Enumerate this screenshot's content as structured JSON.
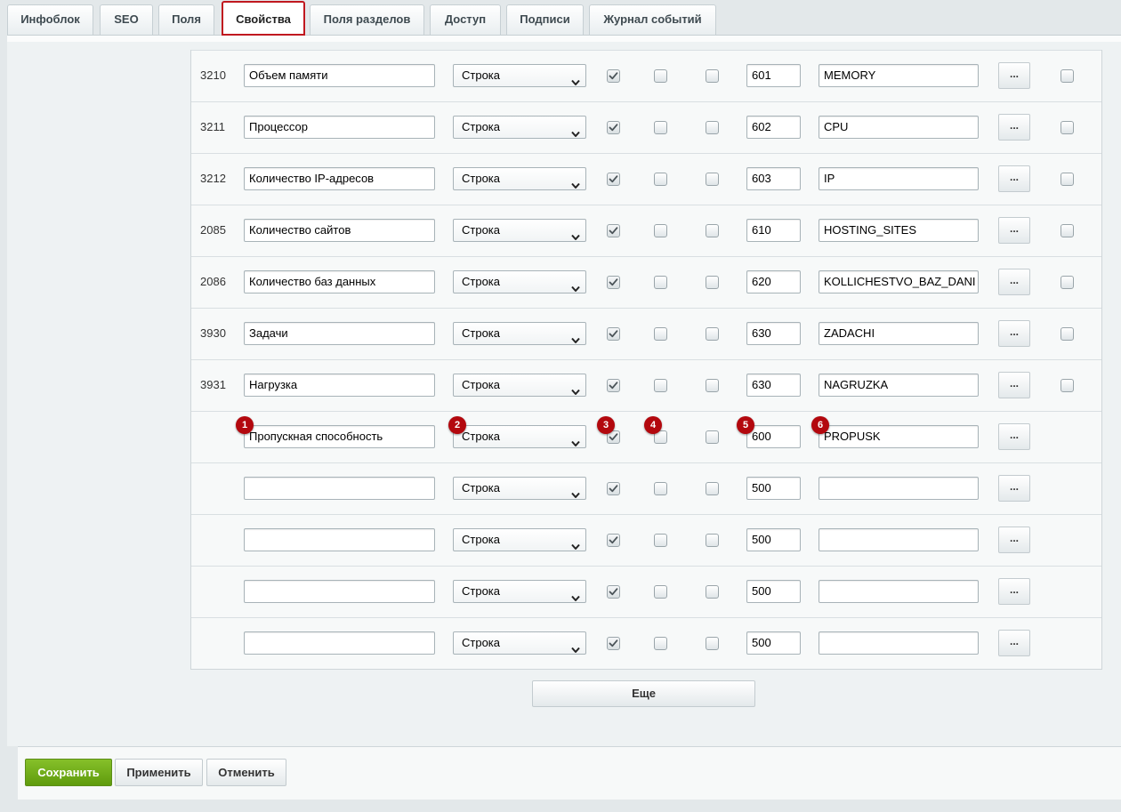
{
  "tabs": [
    {
      "label": "Инфоблок"
    },
    {
      "label": "SEO"
    },
    {
      "label": "Поля"
    },
    {
      "label": "Свойства",
      "active": true
    },
    {
      "label": "Поля разделов"
    },
    {
      "label": "Доступ"
    },
    {
      "label": "Подписи"
    },
    {
      "label": "Журнал событий"
    }
  ],
  "rows": [
    {
      "id": "3210",
      "name": "Объем памяти",
      "type": "Строка",
      "active": true,
      "multiple": false,
      "required": false,
      "sort": "601",
      "code": "MEMORY",
      "more": "...",
      "delete": false
    },
    {
      "id": "3211",
      "name": "Процессор",
      "type": "Строка",
      "active": true,
      "multiple": false,
      "required": false,
      "sort": "602",
      "code": "CPU",
      "more": "...",
      "delete": false
    },
    {
      "id": "3212",
      "name": "Количество IP-адресов",
      "type": "Строка",
      "active": true,
      "multiple": false,
      "required": false,
      "sort": "603",
      "code": "IP",
      "more": "...",
      "delete": false
    },
    {
      "id": "2085",
      "name": "Количество сайтов",
      "type": "Строка",
      "active": true,
      "multiple": false,
      "required": false,
      "sort": "610",
      "code": "HOSTING_SITES",
      "more": "...",
      "delete": false
    },
    {
      "id": "2086",
      "name": "Количество баз данных",
      "type": "Строка",
      "active": true,
      "multiple": false,
      "required": false,
      "sort": "620",
      "code": "KOLLICHESTVO_BAZ_DANI",
      "more": "...",
      "delete": false
    },
    {
      "id": "3930",
      "name": "Задачи",
      "type": "Строка",
      "active": true,
      "multiple": false,
      "required": false,
      "sort": "630",
      "code": "ZADACHI",
      "more": "...",
      "delete": false
    },
    {
      "id": "3931",
      "name": "Нагрузка",
      "type": "Строка",
      "active": true,
      "multiple": false,
      "required": false,
      "sort": "630",
      "code": "NAGRUZKA",
      "more": "...",
      "delete": false
    },
    {
      "id": "",
      "name": "Пропускная способность",
      "type": "Строка",
      "active": true,
      "multiple": false,
      "required": false,
      "sort": "600",
      "code": "PROPUSK",
      "more": "...",
      "delete": null,
      "badges": [
        "1",
        "2",
        "3",
        "4",
        "5",
        "6"
      ]
    },
    {
      "id": "",
      "name": "",
      "type": "Строка",
      "active": true,
      "multiple": false,
      "required": false,
      "sort": "500",
      "code": "",
      "more": "...",
      "delete": null
    },
    {
      "id": "",
      "name": "",
      "type": "Строка",
      "active": true,
      "multiple": false,
      "required": false,
      "sort": "500",
      "code": "",
      "more": "...",
      "delete": null
    },
    {
      "id": "",
      "name": "",
      "type": "Строка",
      "active": true,
      "multiple": false,
      "required": false,
      "sort": "500",
      "code": "",
      "more": "...",
      "delete": null
    },
    {
      "id": "",
      "name": "",
      "type": "Строка",
      "active": true,
      "multiple": false,
      "required": false,
      "sort": "500",
      "code": "",
      "more": "...",
      "delete": null
    }
  ],
  "more_button": "Еще",
  "footer": {
    "save": "Сохранить",
    "apply": "Применить",
    "cancel": "Отменить"
  },
  "colors": {
    "active_tab_border": "#c0181f",
    "badge": "#b3080e",
    "save_button": "#6fab1a"
  }
}
